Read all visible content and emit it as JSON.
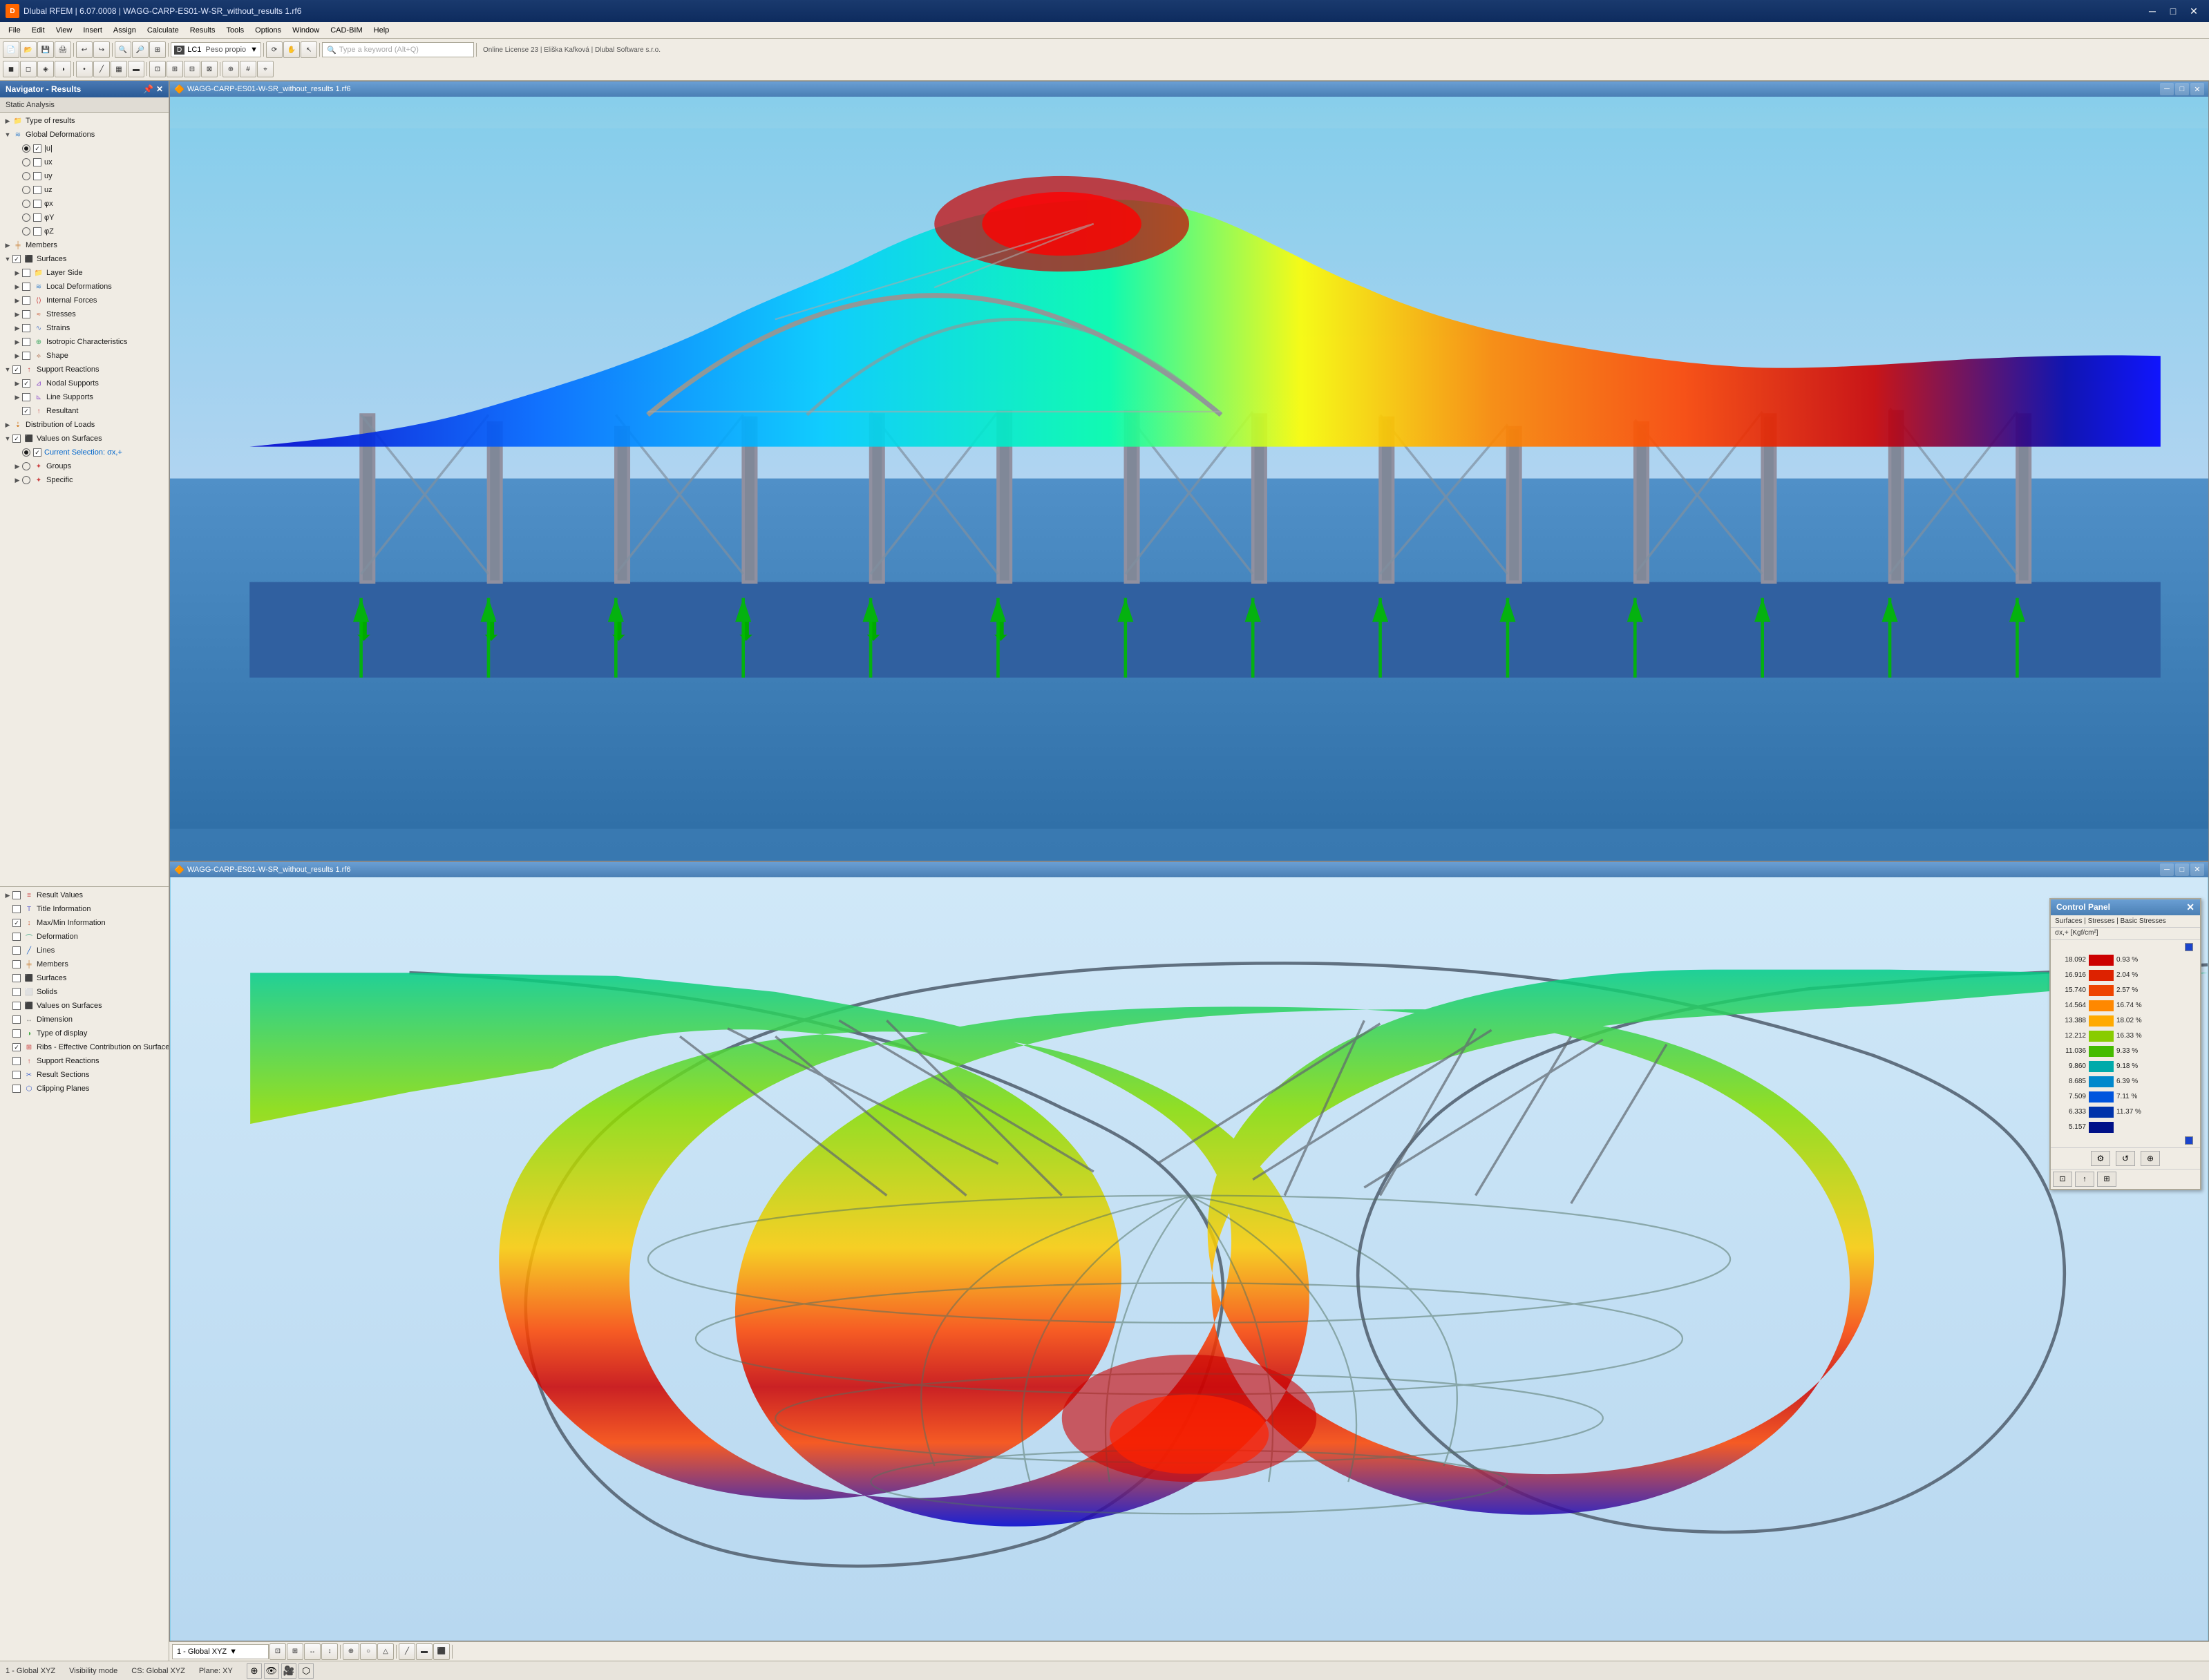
{
  "app": {
    "title": "Dlubal RFEM | 6.07.0008 | WAGG-CARP-ES01-W-SR_without_results 1.rf6",
    "icon": "D",
    "file": "WAGG-CARP-ES01-W-SR_without_results 1.rf6"
  },
  "menu": {
    "items": [
      "File",
      "Edit",
      "View",
      "Insert",
      "Assign",
      "Calculate",
      "Results",
      "Tools",
      "Options",
      "Window",
      "CAD-BIM",
      "Help"
    ]
  },
  "navigator": {
    "title": "Navigator - Results",
    "subtitle": "Static Analysis",
    "tree": {
      "typeOfResults": "Type of results",
      "globalDeformations": "Global Deformations",
      "deformComponents": [
        "|u|",
        "ux",
        "uy",
        "uz",
        "φx",
        "φY",
        "φZ"
      ],
      "members": "Members",
      "surfaces": "Surfaces",
      "layerSide": "Layer Side",
      "localDeformations": "Local Deformations",
      "internalForces": "Internal Forces",
      "stresses": "Stresses",
      "strains": "Strains",
      "isotropicCharacteristics": "Isotropic Characteristics",
      "shape": "Shape",
      "supportReactions": "Support Reactions",
      "nodalSupports": "Nodal Supports",
      "lineSupports": "Line Supports",
      "resultant": "Resultant",
      "distributionOfLoads": "Distribution of Loads",
      "valuesOnSurfaces": "Values on Surfaces",
      "currentSelection": "Current Selection: σx,+",
      "groups": "Groups",
      "specific": "Specific"
    }
  },
  "navigatorBottom": {
    "items": [
      "Result Values",
      "Title Information",
      "Max/Min Information",
      "Deformation",
      "Lines",
      "Members",
      "Surfaces",
      "Solids",
      "Values on Surfaces",
      "Dimension",
      "Type of display",
      "Ribs - Effective Contribution on Surface/Member",
      "Support Reactions",
      "Result Sections",
      "Clipping Planes"
    ],
    "checked": [
      2,
      11,
      12
    ]
  },
  "viewport1": {
    "title": "WAGG-CARP-ES01-W-SR_without_results 1.rf6",
    "buttons": [
      "─",
      "□",
      "✕"
    ]
  },
  "viewport2": {
    "title": "WAGG-CARP-ES01-W-SR_without_results 1.rf6",
    "buttons": [
      "─",
      "□",
      "✕"
    ]
  },
  "controlPanel": {
    "title": "Control Panel",
    "close": "✕",
    "subtitle1": "Surfaces | Stresses | Basic Stresses",
    "subtitle2": "σx,+ [Kgf/cm²]",
    "maxIndicator": "▣",
    "minIndicator": "▣",
    "legend": [
      {
        "value": "18.092",
        "color": "#cc0000",
        "percent": "0.93 %",
        "indicator": "max"
      },
      {
        "value": "16.916",
        "color": "#dd2200",
        "percent": "2.04 %"
      },
      {
        "value": "15.740",
        "color": "#ee4400",
        "percent": "2.57 %"
      },
      {
        "value": "14.564",
        "color": "#ff8800",
        "percent": "16.74 %"
      },
      {
        "value": "13.388",
        "color": "#ffaa00",
        "percent": "18.02 %"
      },
      {
        "value": "12.212",
        "color": "#88cc00",
        "percent": "16.33 %"
      },
      {
        "value": "11.036",
        "color": "#44bb00",
        "percent": "9.33 %"
      },
      {
        "value": "9.860",
        "color": "#00aaaa",
        "percent": "9.18 %"
      },
      {
        "value": "8.685",
        "color": "#0088cc",
        "percent": "6.39 %"
      },
      {
        "value": "7.509",
        "color": "#0055dd",
        "percent": "7.11 %"
      },
      {
        "value": "6.333",
        "color": "#0033aa",
        "percent": "11.37 %"
      },
      {
        "value": "5.157",
        "color": "#001188",
        "percent": "",
        "indicator": "min"
      }
    ]
  },
  "statusBar": {
    "left": "1 - Global XYZ",
    "visibilityMode": "Visibility mode",
    "cs": "CS: Global XYZ",
    "plane": "Plane: XY"
  },
  "toolbar": {
    "loadCase": "LC1",
    "loadCaseName": "Peso propio",
    "searchPlaceholder": "Type a keyword (Alt+Q)",
    "license": "Online License 23 | Eliška Kafková | Dlubal Software s.r.o."
  }
}
